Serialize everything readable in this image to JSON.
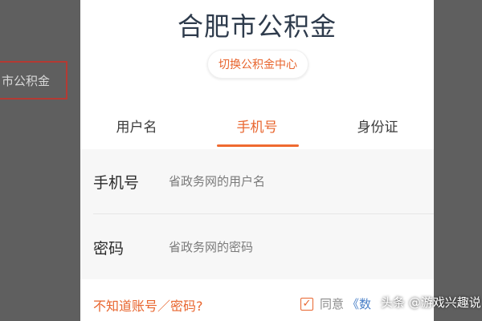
{
  "background": {
    "box_text": "市公积金"
  },
  "sheet": {
    "title": "合肥市公积金",
    "switch_center_label": "切换公积金中心",
    "tabs": [
      {
        "label": "用户名",
        "active": false
      },
      {
        "label": "手机号",
        "active": true
      },
      {
        "label": "身份证",
        "active": false
      }
    ],
    "fields": {
      "phone_label": "手机号",
      "phone_value": "",
      "phone_placeholder": "省政务网的用户名",
      "password_label": "密码",
      "password_value": "",
      "password_placeholder": "省政务网的密码"
    },
    "forgot_label": "不知道账号／密码?",
    "agree": {
      "checked": true,
      "label": "同意",
      "link_text": "《数"
    }
  },
  "watermark": {
    "text": "头条 @游戏兴趣说"
  },
  "colors": {
    "accent": "#e8652e",
    "title": "#2e3b4c",
    "overlay": "#5f5f5f",
    "link": "#4a80c8"
  }
}
